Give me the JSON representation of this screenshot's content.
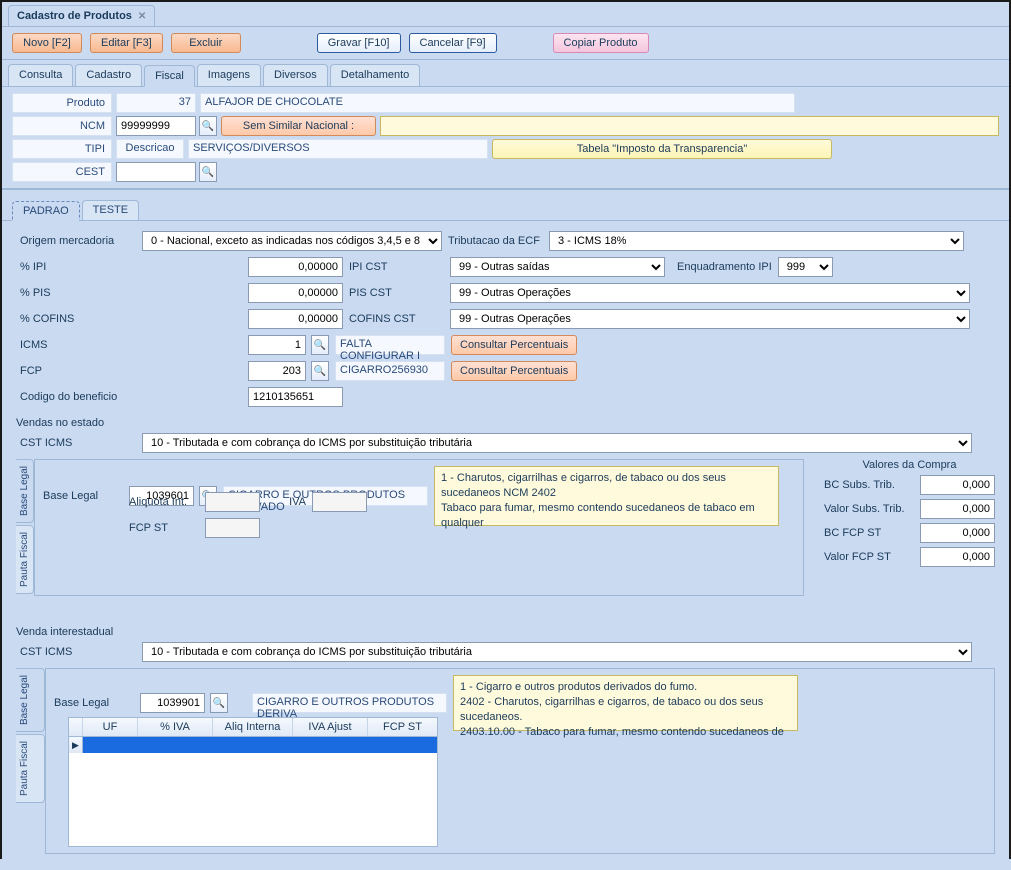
{
  "window": {
    "title": "Cadastro de Produtos"
  },
  "toolbar": {
    "novo": "Novo [F2]",
    "editar": "Editar [F3]",
    "excluir": "Excluir",
    "gravar": "Gravar [F10]",
    "cancelar": "Cancelar [F9]",
    "copiar": "Copiar Produto"
  },
  "tabs": {
    "consulta": "Consulta",
    "cadastro": "Cadastro",
    "fiscal": "Fiscal",
    "imagens": "Imagens",
    "diversos": "Diversos",
    "detalhamento": "Detalhamento"
  },
  "header": {
    "produto_label": "Produto",
    "produto_id": "37",
    "produto_nome": "ALFAJOR DE CHOCOLATE",
    "ncm_label": "NCM",
    "ncm_value": "99999999",
    "similar_btn": "Sem Similar Nacional  :",
    "tipi_label": "TIPI",
    "descricao_label": "Descricao",
    "descricao_value": "SERVIÇOS/DIVERSOS",
    "tabela_btn": "Tabela \"Imposto da Transparencia\"",
    "cest_label": "CEST",
    "cest_value": ""
  },
  "subtabs": {
    "padrao": "PADRAO",
    "teste": "TESTE"
  },
  "fiscal": {
    "origem_label": "Origem mercadoria",
    "origem_value": "0 - Nacional, exceto as indicadas nos códigos 3,4,5 e 8",
    "trib_ecf_label": "Tributacao da ECF",
    "trib_ecf_value": "3  - ICMS 18%",
    "pct_ipi_label": "% IPI",
    "pct_ipi_value": "0,00000",
    "ipi_cst_label": "IPI CST",
    "ipi_cst_value": "99 - Outras saídas",
    "enq_ipi_label": "Enquadramento IPI",
    "enq_ipi_value": "999",
    "pct_pis_label": "% PIS",
    "pct_pis_value": "0,00000",
    "pis_cst_label": "PIS CST",
    "pis_cst_value": "99 - Outras Operações",
    "pct_cofins_label": "% COFINS",
    "pct_cofins_value": "0,00000",
    "cofins_cst_label": "COFINS CST",
    "cofins_cst_value": "99 - Outras Operações",
    "icms_label": "ICMS",
    "icms_value": "1",
    "icms_desc": "FALTA CONFIGURAR I",
    "consultar_btn": "Consultar Percentuais",
    "fcp_label": "FCP",
    "fcp_value": "203",
    "fcp_desc": "CIGARRO256930",
    "codben_label": "Codigo do beneficio",
    "codben_value": "1210135651"
  },
  "vendas_estado": {
    "title": "Vendas no estado",
    "cst_icms_label": "CST ICMS",
    "cst_icms_value": "10 - Tributada e com cobrança do ICMS por substituição tributária",
    "vtab_base": "Base Legal",
    "vtab_pauta": "Pauta Fiscal",
    "base_legal_label": "Base Legal",
    "base_legal_code": "1039601",
    "base_legal_desc": "CIGARRO E OUTROS PRODUTOS DERIVADO",
    "aliquota_label": "Aliquota Int.",
    "iva_label": "IVA",
    "fcp_st_label": "FCP ST",
    "info_text": "1 - Charutos, cigarrilhas e cigarros, de tabaco ou dos seus sucedaneos NCM 2402\nTabaco para fumar, mesmo contendo sucedaneos de tabaco em qualquer",
    "valores_title": "Valores da Compra",
    "bc_subs_label": "BC Subs. Trib.",
    "bc_subs_value": "0,000",
    "valor_subs_label": "Valor Subs. Trib.",
    "valor_subs_value": "0,000",
    "bc_fcp_label": "BC FCP ST",
    "bc_fcp_value": "0,000",
    "valor_fcp_label": "Valor FCP ST",
    "valor_fcp_value": "0,000"
  },
  "venda_inter": {
    "title": "Venda interestadual",
    "cst_icms_label": "CST ICMS",
    "cst_icms_value": "10 - Tributada e com cobrança do ICMS por substituição tributária",
    "base_legal_label": "Base Legal",
    "base_legal_code": "1039901",
    "base_legal_desc": "CIGARRO E OUTROS PRODUTOS DERIVA",
    "info_text": "1 - Cigarro e outros produtos derivados do fumo.\n2402 - Charutos, cigarrilhas e cigarros, de tabaco ou dos seus sucedaneos.\n2403.10.00 - Tabaco para fumar, mesmo contendo sucedaneos de",
    "columns": {
      "uf": "UF",
      "pct_iva": "% IVA",
      "aliq": "Aliq Interna",
      "iva_ajust": "IVA Ajust",
      "fcp_st": "FCP ST"
    }
  }
}
